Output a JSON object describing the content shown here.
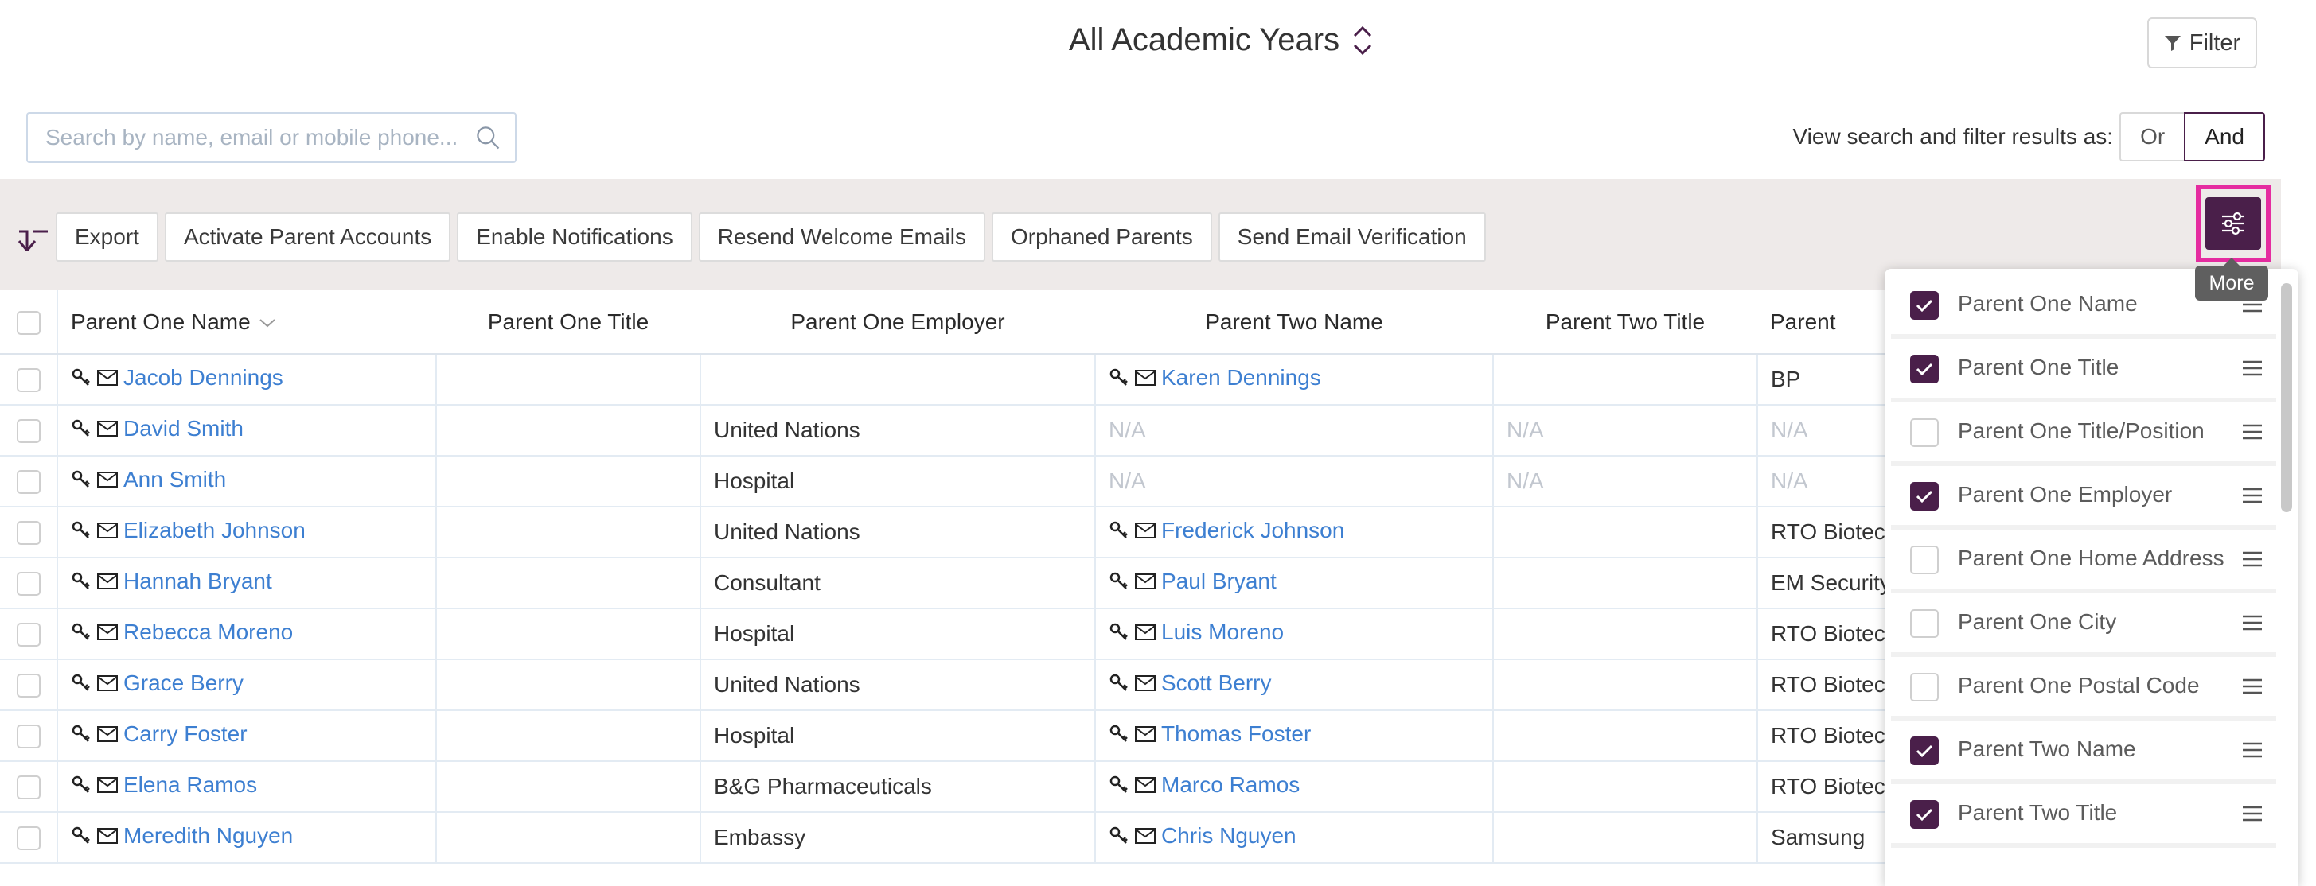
{
  "header": {
    "title": "All Academic Years",
    "filter_label": "Filter"
  },
  "search": {
    "placeholder": "Search by name, email or mobile phone..."
  },
  "view_as": {
    "label": "View search and filter results as:",
    "or_label": "Or",
    "and_label": "And",
    "selected": "And"
  },
  "toolbar": {
    "actions": [
      "Export",
      "Activate Parent Accounts",
      "Enable Notifications",
      "Resend Welcome Emails",
      "Orphaned Parents",
      "Send Email Verification"
    ],
    "more_tooltip": "More"
  },
  "colors": {
    "accent": "#4a1f4a",
    "highlight": "#e52ca0",
    "link": "#3d7fd1"
  },
  "table": {
    "columns": [
      "Parent One Name",
      "Parent One Title",
      "Parent One Employer",
      "Parent Two Name",
      "Parent Two Title",
      "Parent"
    ],
    "rows": [
      {
        "p1_name": "Jacob Dennings",
        "p1_title": "",
        "p1_employer": "",
        "p2_name": "Karen Dennings",
        "p2_title": "",
        "p2_employer": "BP"
      },
      {
        "p1_name": "David Smith",
        "p1_title": "",
        "p1_employer": "United Nations",
        "p2_name": "N/A",
        "p2_title": "N/A",
        "p2_employer": "N/A"
      },
      {
        "p1_name": "Ann Smith",
        "p1_title": "",
        "p1_employer": "Hospital",
        "p2_name": "N/A",
        "p2_title": "N/A",
        "p2_employer": "N/A"
      },
      {
        "p1_name": "Elizabeth Johnson",
        "p1_title": "",
        "p1_employer": "United Nations",
        "p2_name": "Frederick Johnson",
        "p2_title": "",
        "p2_employer": "RTO Biotech"
      },
      {
        "p1_name": "Hannah Bryant",
        "p1_title": "",
        "p1_employer": "Consultant",
        "p2_name": "Paul Bryant",
        "p2_title": "",
        "p2_employer": "EM Security"
      },
      {
        "p1_name": "Rebecca Moreno",
        "p1_title": "",
        "p1_employer": "Hospital",
        "p2_name": "Luis Moreno",
        "p2_title": "",
        "p2_employer": "RTO Biotech"
      },
      {
        "p1_name": "Grace Berry",
        "p1_title": "",
        "p1_employer": "United Nations",
        "p2_name": "Scott Berry",
        "p2_title": "",
        "p2_employer": "RTO Biotech"
      },
      {
        "p1_name": "Carry Foster",
        "p1_title": "",
        "p1_employer": "Hospital",
        "p2_name": "Thomas Foster",
        "p2_title": "",
        "p2_employer": "RTO Biotech"
      },
      {
        "p1_name": "Elena Ramos",
        "p1_title": "",
        "p1_employer": "B&G Pharmaceuticals",
        "p2_name": "Marco Ramos",
        "p2_title": "",
        "p2_employer": "RTO Biotech"
      },
      {
        "p1_name": "Meredith Nguyen",
        "p1_title": "",
        "p1_employer": "Embassy",
        "p2_name": "Chris Nguyen",
        "p2_title": "",
        "p2_employer": "Samsung"
      }
    ]
  },
  "column_picker": {
    "items": [
      {
        "label": "Parent One Name",
        "checked": true
      },
      {
        "label": "Parent One Title",
        "checked": true
      },
      {
        "label": "Parent One Title/Position",
        "checked": false
      },
      {
        "label": "Parent One Employer",
        "checked": true
      },
      {
        "label": "Parent One Home Address",
        "checked": false
      },
      {
        "label": "Parent One City",
        "checked": false
      },
      {
        "label": "Parent One Postal Code",
        "checked": false
      },
      {
        "label": "Parent Two Name",
        "checked": true
      },
      {
        "label": "Parent Two Title",
        "checked": true
      }
    ]
  }
}
